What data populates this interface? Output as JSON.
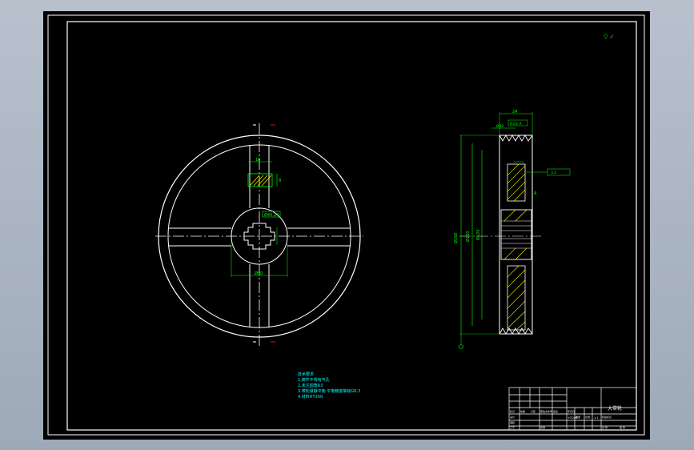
{
  "drawing": {
    "title_cell": "大带轮",
    "corner_mark": "▽ ✓"
  },
  "front_view": {
    "keyway_width_label": "16",
    "keyway_depth_label": "8",
    "hub_label": "Ø40.24",
    "bore_label": "Ø50"
  },
  "side_view": {
    "width_label": "24",
    "groove_callout": "0.02 A",
    "pitch_label": "Ø30",
    "outer_diameter_label": "Ø160",
    "groove_diameter_label": "Ø150",
    "inner_diameter_label": "Ø120",
    "roughness_label": "3.2",
    "datum_label": "A"
  },
  "tech_notes": {
    "heading": "技术要求",
    "line1": "1.铸件不得有气孔",
    "line2": "2.未注圆角R3",
    "line3": "3.带轮做静平衡  平衡精度等级G6.3",
    "line4": "4.材料HT200"
  },
  "title_block": {
    "material": "HT200",
    "scale": "1:1",
    "labels": [
      "标记",
      "处数",
      "分区",
      "更改文件号",
      "签名",
      "年月日",
      "设计",
      "审核",
      "工艺",
      "批准",
      "阶段标记",
      "重量",
      "比例",
      "共 张",
      "第 张"
    ]
  },
  "colors": {
    "line": "#ffffff",
    "dimension": "#00ff00",
    "section": "#ffff00",
    "center": "#ff0000",
    "notes": "#00ffff",
    "background": "#000000"
  }
}
